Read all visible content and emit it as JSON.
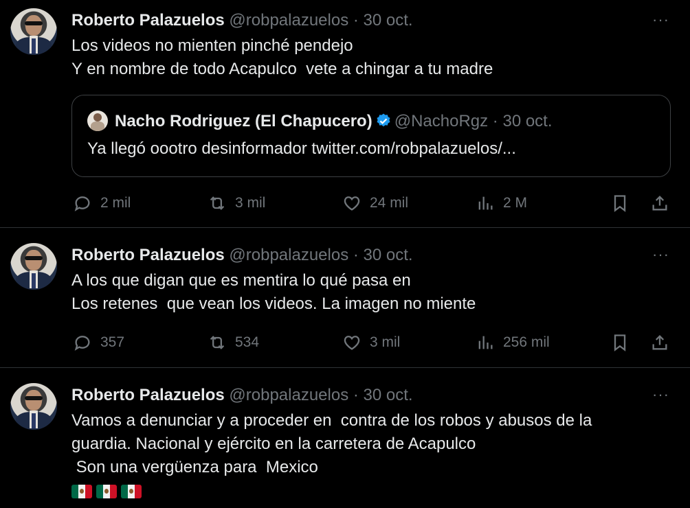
{
  "tweets": [
    {
      "name": "Roberto Palazuelos",
      "handle": "@robpalazuelos",
      "separator": "·",
      "date": "30 oct.",
      "more": "···",
      "text": "Los videos no mienten pinché pendejo\nY en nombre de todo Acapulco  vete a chingar a tu madre",
      "quote": {
        "name": "Nacho Rodriguez (El Chapucero)",
        "handle": "@NachoRgz",
        "separator": "·",
        "date": "30 oct.",
        "text": "Ya llegó oootro desinformador twitter.com/robpalazuelos/..."
      },
      "replies": "2 mil",
      "retweets": "3 mil",
      "likes": "24 mil",
      "views": "2 M"
    },
    {
      "name": "Roberto Palazuelos",
      "handle": "@robpalazuelos",
      "separator": "·",
      "date": "30 oct.",
      "more": "···",
      "text": "A los que digan que es mentira lo qué pasa en\nLos retenes  que vean los videos. La imagen no miente",
      "replies": "357",
      "retweets": "534",
      "likes": "3 mil",
      "views": "256 mil"
    },
    {
      "name": "Roberto Palazuelos",
      "handle": "@robpalazuelos",
      "separator": "·",
      "date": "30 oct.",
      "more": "···",
      "text": "Vamos a denunciar y a proceder en  contra de los robos y abusos de la\nguardia. Nacional y ejército en la carretera de Acapulco\n Son una vergüenza para  Mexico",
      "flags": "🇲🇽🇲🇽🇲🇽"
    }
  ],
  "icons": {
    "reply": "reply-icon",
    "retweet": "retweet-icon",
    "like": "heart-icon",
    "views": "views-icon",
    "bookmark": "bookmark-icon",
    "share": "share-icon",
    "verified": "verified-badge-icon"
  },
  "colors": {
    "background": "#000000",
    "text": "#e7e9ea",
    "secondary": "#71767b",
    "divider": "#2f3336",
    "verified": "#1d9bf0"
  }
}
